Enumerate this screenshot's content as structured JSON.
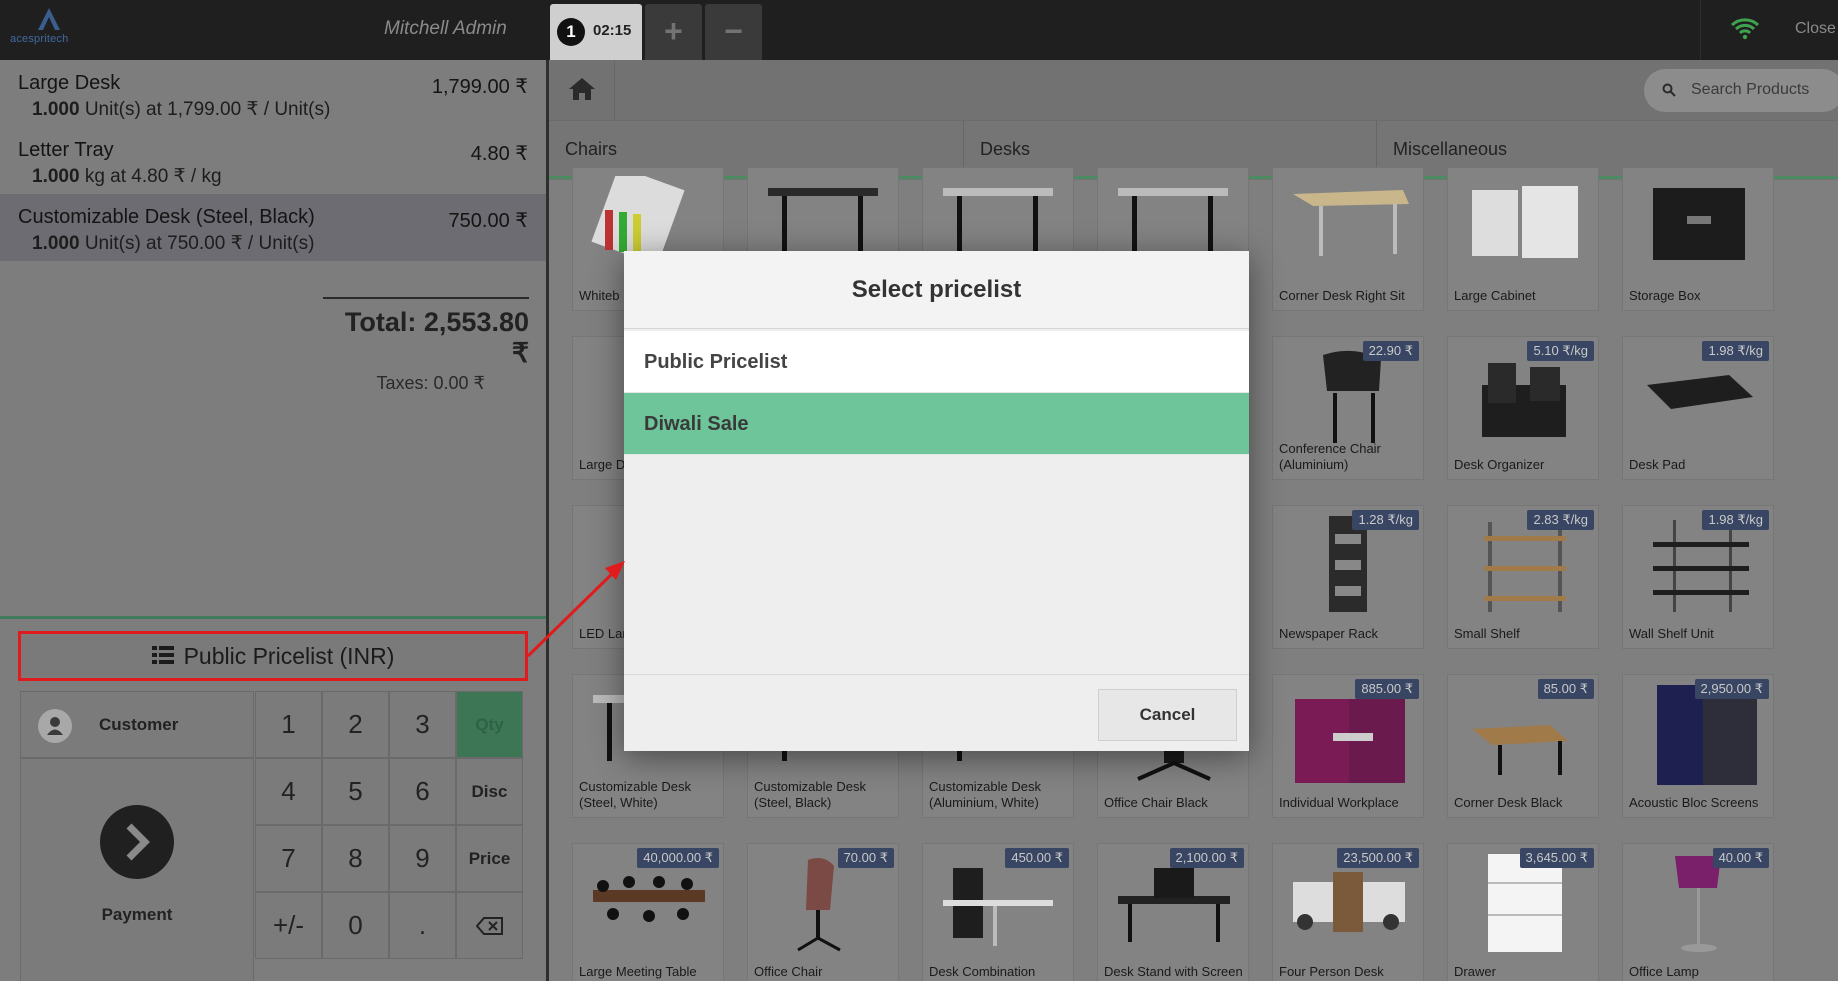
{
  "app": {
    "logo_text": "acespritech",
    "user": "Mitchell Admin",
    "order_tab": {
      "number": "1",
      "time": "02:15"
    },
    "add_symbol": "+",
    "remove_symbol": "−",
    "close_label": "Close",
    "wifi_color": "#3fa34d"
  },
  "order": {
    "lines": [
      {
        "name": "Large Desk",
        "price": "1,799.00 ₹",
        "qty": "1.000",
        "detail": " Unit(s) at 1,799.00 ₹ / Unit(s)"
      },
      {
        "name": "Letter Tray",
        "price": "4.80 ₹",
        "qty": "1.000",
        "detail": " kg at 4.80 ₹ / kg"
      },
      {
        "name": "Customizable Desk (Steel, Black)",
        "price": "750.00 ₹",
        "qty": "1.000",
        "detail": " Unit(s) at 750.00 ₹ / Unit(s)"
      }
    ],
    "total": "Total: 2,553.80 ₹",
    "taxes": "Taxes: 0.00 ₹"
  },
  "pricelist_button": "Public Pricelist (INR)",
  "numpad": {
    "customer": "Customer",
    "payment": "Payment",
    "keys": [
      "1",
      "2",
      "3",
      "4",
      "5",
      "6",
      "7",
      "8",
      "9",
      "+/-",
      "0",
      "."
    ],
    "modes": [
      "Qty",
      "Disc",
      "Price"
    ]
  },
  "search": {
    "placeholder": "Search Products"
  },
  "categories": [
    "Chairs",
    "Desks",
    "Miscellaneous"
  ],
  "products": [
    {
      "name": "Whiteb",
      "tag": ""
    },
    {
      "name": "",
      "tag": ""
    },
    {
      "name": "",
      "tag": ""
    },
    {
      "name": "",
      "tag": ""
    },
    {
      "name": "Corner Desk Right Sit",
      "tag": ""
    },
    {
      "name": "Large Cabinet",
      "tag": ""
    },
    {
      "name": "Storage Box",
      "tag": ""
    },
    {
      "name": "Large D",
      "tag": ""
    },
    {
      "name": "",
      "tag": ""
    },
    {
      "name": "",
      "tag": ""
    },
    {
      "name": "",
      "tag": ""
    },
    {
      "name": "Conference Chair (Aluminium)",
      "tag": "22.90 ₹"
    },
    {
      "name": "Desk Organizer",
      "tag": "5.10 ₹/kg"
    },
    {
      "name": "Desk Pad",
      "tag": "1.98 ₹/kg"
    },
    {
      "name": "LED Lar",
      "tag": ""
    },
    {
      "name": "",
      "tag": ""
    },
    {
      "name": "",
      "tag": ""
    },
    {
      "name": "",
      "tag": ""
    },
    {
      "name": "Newspaper Rack",
      "tag": "1.28 ₹/kg"
    },
    {
      "name": "Small Shelf",
      "tag": "2.83 ₹/kg"
    },
    {
      "name": "Wall Shelf Unit",
      "tag": "1.98 ₹/kg"
    },
    {
      "name": "Customizable Desk (Steel, White)",
      "tag": ""
    },
    {
      "name": "Customizable Desk (Steel, Black)",
      "tag": ""
    },
    {
      "name": "Customizable Desk (Aluminium, White)",
      "tag": ""
    },
    {
      "name": "Office Chair Black",
      "tag": ""
    },
    {
      "name": "Individual Workplace",
      "tag": "885.00 ₹"
    },
    {
      "name": "Corner Desk Black",
      "tag": "85.00 ₹"
    },
    {
      "name": "Acoustic Bloc Screens",
      "tag": "2,950.00 ₹"
    },
    {
      "name": "Large Meeting Table",
      "tag": "40,000.00 ₹"
    },
    {
      "name": "Office Chair",
      "tag": "70.00 ₹"
    },
    {
      "name": "Desk Combination",
      "tag": "450.00 ₹"
    },
    {
      "name": "Desk Stand with Screen",
      "tag": "2,100.00 ₹"
    },
    {
      "name": "Four Person Desk",
      "tag": "23,500.00 ₹"
    },
    {
      "name": "Drawer",
      "tag": "3,645.00 ₹"
    },
    {
      "name": "Office Lamp",
      "tag": "40.00 ₹"
    }
  ],
  "modal": {
    "title": "Select pricelist",
    "options": [
      {
        "label": "Public Pricelist",
        "selected": false
      },
      {
        "label": "Diwali Sale",
        "selected": true
      }
    ],
    "cancel": "Cancel",
    "selected_color": "#6ec59a"
  },
  "annotation_color": "#e11b1b"
}
